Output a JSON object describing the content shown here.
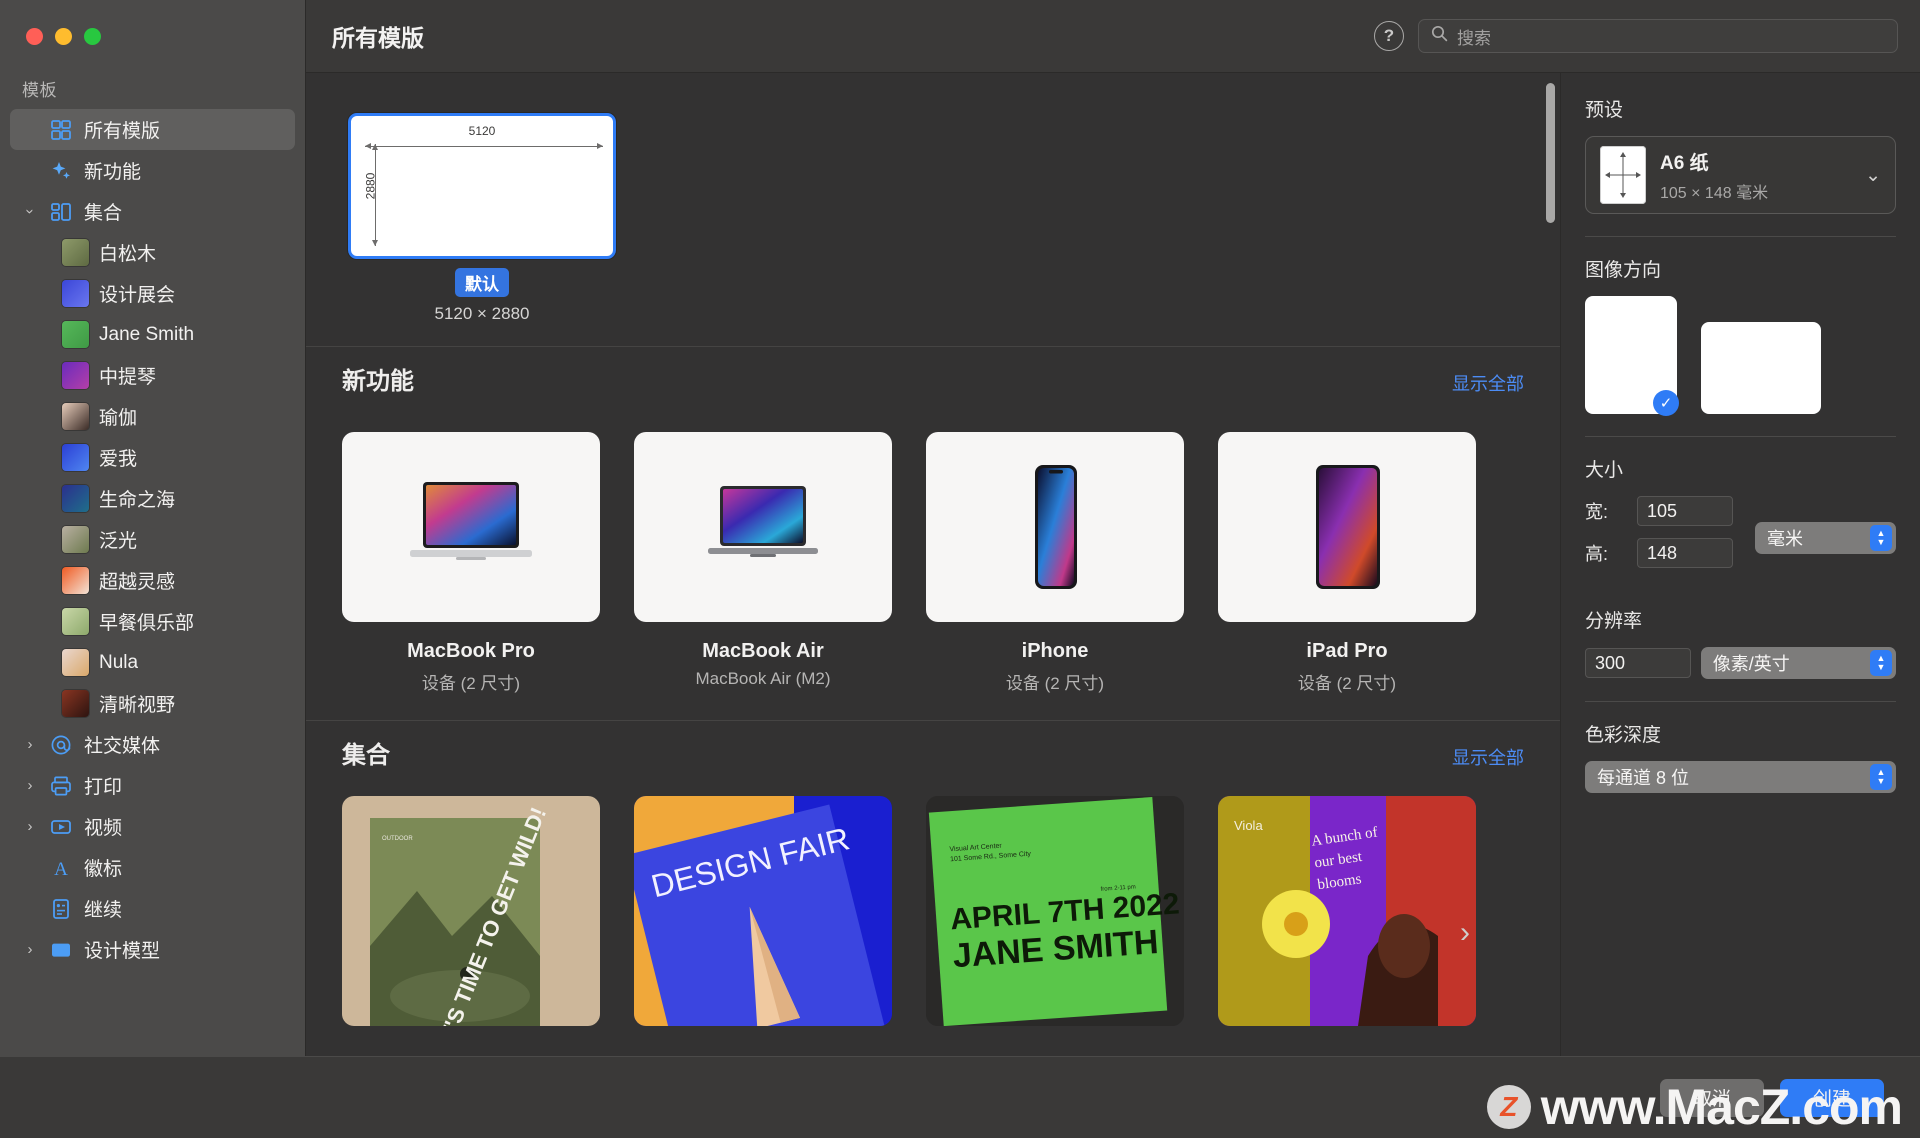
{
  "window": {
    "traffic_lights": [
      "close",
      "minimize",
      "zoom"
    ]
  },
  "header": {
    "title": "所有模版",
    "help_label": "?",
    "search_placeholder": "搜索"
  },
  "sidebar": {
    "section_label": "模板",
    "items": [
      {
        "label": "所有模版",
        "icon": "grid-icon",
        "selected": true,
        "level": 0,
        "twisty": "none"
      },
      {
        "label": "新功能",
        "icon": "sparkles-icon",
        "selected": false,
        "level": 0,
        "twisty": "none"
      },
      {
        "label": "集合",
        "icon": "collection-icon",
        "selected": false,
        "level": 0,
        "twisty": "open"
      },
      {
        "label": "白松木",
        "icon": "thumb",
        "selected": false,
        "level": 1,
        "twisty": "none",
        "colors": [
          "#8e9a6a",
          "#5e6a42"
        ]
      },
      {
        "label": "设计展会",
        "icon": "thumb",
        "selected": false,
        "level": 1,
        "twisty": "none",
        "colors": [
          "#3b46d8",
          "#6a77ef"
        ]
      },
      {
        "label": "Jane Smith",
        "icon": "thumb",
        "selected": false,
        "level": 1,
        "twisty": "none",
        "colors": [
          "#56b85a",
          "#3f9a45"
        ]
      },
      {
        "label": "中提琴",
        "icon": "thumb",
        "selected": false,
        "level": 1,
        "twisty": "none",
        "colors": [
          "#6a2bbd",
          "#b43fa8"
        ]
      },
      {
        "label": "瑜伽",
        "icon": "thumb",
        "selected": false,
        "level": 1,
        "twisty": "none",
        "colors": [
          "#e7cdbb",
          "#3a2b26"
        ]
      },
      {
        "label": "爱我",
        "icon": "thumb",
        "selected": false,
        "level": 1,
        "twisty": "none",
        "colors": [
          "#2b3fd6",
          "#4f86f0"
        ]
      },
      {
        "label": "生命之海",
        "icon": "thumb",
        "selected": false,
        "level": 1,
        "twisty": "none",
        "colors": [
          "#2b2f8e",
          "#1f6f8a"
        ]
      },
      {
        "label": "泛光",
        "icon": "thumb",
        "selected": false,
        "level": 1,
        "twisty": "none",
        "colors": [
          "#b9b0a2",
          "#6d7a4e"
        ]
      },
      {
        "label": "超越灵感",
        "icon": "thumb",
        "selected": false,
        "level": 1,
        "twisty": "none",
        "colors": [
          "#f05a22",
          "#f2e3d6"
        ]
      },
      {
        "label": "早餐俱乐部",
        "icon": "thumb",
        "selected": false,
        "level": 1,
        "twisty": "none",
        "colors": [
          "#c9d7a8",
          "#8da96b"
        ]
      },
      {
        "label": "Nula",
        "icon": "thumb",
        "selected": false,
        "level": 1,
        "twisty": "none",
        "colors": [
          "#ead7cf",
          "#d9a86a"
        ]
      },
      {
        "label": "清晰视野",
        "icon": "thumb",
        "selected": false,
        "level": 1,
        "twisty": "none",
        "colors": [
          "#8a3522",
          "#2d1410"
        ]
      },
      {
        "label": "社交媒体",
        "icon": "at-icon",
        "selected": false,
        "level": 0,
        "twisty": "closed"
      },
      {
        "label": "打印",
        "icon": "printer-icon",
        "selected": false,
        "level": 0,
        "twisty": "closed"
      },
      {
        "label": "视频",
        "icon": "play-icon",
        "selected": false,
        "level": 0,
        "twisty": "closed"
      },
      {
        "label": "徽标",
        "icon": "typography-icon",
        "selected": false,
        "level": 0,
        "twisty": "none"
      },
      {
        "label": "继续",
        "icon": "document-icon",
        "selected": false,
        "level": 0,
        "twisty": "none"
      },
      {
        "label": "设计模型",
        "icon": "rectangle-icon",
        "selected": false,
        "level": 0,
        "twisty": "closed"
      }
    ]
  },
  "preview": {
    "width_label": "5120",
    "height_label": "2880",
    "badge": "默认",
    "dimensions": "5120 × 2880"
  },
  "sections": [
    {
      "title": "新功能",
      "show_all": "显示全部",
      "cards": [
        {
          "name": "MacBook Pro",
          "sub": "设备 (2 尺寸)",
          "art": "macbook-pro"
        },
        {
          "name": "MacBook Air",
          "sub": "MacBook Air (M2)",
          "art": "macbook-air"
        },
        {
          "name": "iPhone",
          "sub": "设备 (2 尺寸)",
          "art": "iphone"
        },
        {
          "name": "iPad Pro",
          "sub": "设备 (2 尺寸)",
          "art": "ipad-pro"
        }
      ]
    },
    {
      "title": "集合",
      "show_all": "显示全部",
      "cards": [
        {
          "art": "wild-poster",
          "text": "IT'S TIME TO GET WILD"
        },
        {
          "art": "design-fair-poster",
          "text": "DESIGN FAIR"
        },
        {
          "art": "jane-smith-poster",
          "text": "APRIL 7TH 2022 JANE SMITH"
        },
        {
          "art": "blooms-poster",
          "text": "A bunch of our best blooms"
        }
      ]
    }
  ],
  "inspector": {
    "preset": {
      "label": "预设",
      "name": "A6 纸",
      "dimensions": "105 × 148 毫米"
    },
    "orientation": {
      "label": "图像方向",
      "portrait_selected": true,
      "check_glyph": "✓"
    },
    "size": {
      "label": "大小",
      "width_label": "宽:",
      "width_value": "105",
      "height_label": "高:",
      "height_value": "148",
      "unit": "毫米"
    },
    "resolution": {
      "label": "分辨率",
      "value": "300",
      "unit": "像素/英寸"
    },
    "color_depth": {
      "label": "色彩深度",
      "value": "每通道 8 位"
    }
  },
  "footer": {
    "cancel": "取消",
    "create": "创建"
  },
  "watermark": {
    "logo": "Z",
    "text": "www.MacZ.com"
  },
  "colors": {
    "accent": "#2f7cf6",
    "link": "#4c8cf5",
    "sidebar_bg": "#4b4a49",
    "content_bg": "#333232"
  }
}
